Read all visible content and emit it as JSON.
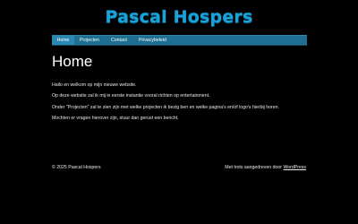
{
  "site": {
    "title": "Pascal Hospers",
    "title_color": "#1aa3d8"
  },
  "nav": {
    "bar_color": "#1f6f92",
    "items": [
      {
        "label": "Home",
        "active": true
      },
      {
        "label": "Projecten",
        "active": false
      },
      {
        "label": "Contact",
        "active": false
      },
      {
        "label": "Privacybeleid",
        "active": false
      }
    ]
  },
  "main": {
    "heading": "Home",
    "paragraphs": [
      "Hallo en welkom op mijn nieuwe website.",
      "Op deze website zal ik mij in eerste instantie vooral richten op entertainment.",
      "Onder \"Projecten\" zal te zien zijn met welke projecten ik bezig ben en welke pagina's en/of logo's hierbij horen.",
      "Mochten er vragen hierover zijn, stuur dan gerust een bericht."
    ]
  },
  "footer": {
    "copyright": "© 2025 Pascal Hospers",
    "powered_prefix": "Met trots aangedreven door ",
    "powered_link": "WordPress"
  },
  "background_color": "#000000"
}
